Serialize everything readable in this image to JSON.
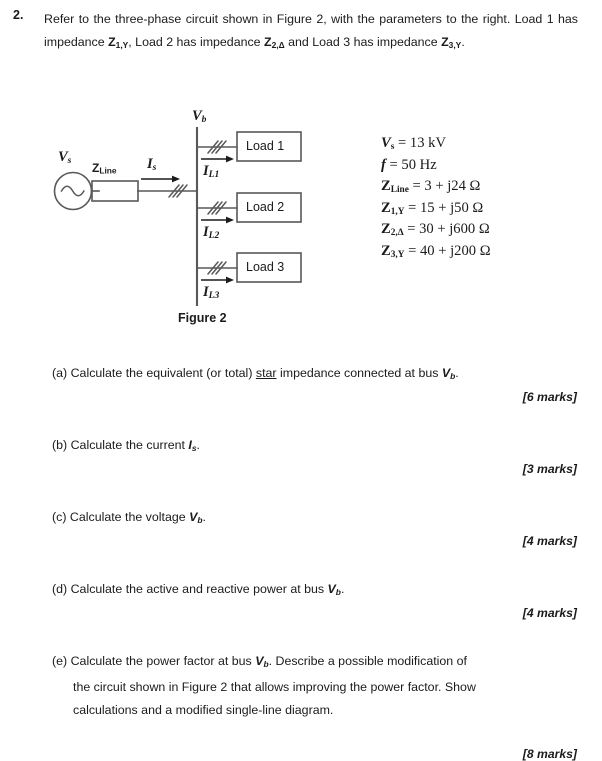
{
  "question": {
    "number": "2.",
    "stem_line1": "Refer to the three-phase circuit shown in Figure 2, with the parameters to the",
    "stem_line2_a": "right. Load 1 has impedance ",
    "stem_line2_z1": "Z",
    "stem_line2_z1sub": "1,Y",
    "stem_line2_b": ", Load 2 has impedance ",
    "stem_line2_z2": "Z",
    "stem_line2_z2sub": "2,Δ",
    "stem_line2_c": " and Load 3 has",
    "stem_line3_a": "impedance ",
    "stem_line3_z3": "Z",
    "stem_line3_z3sub": "3,Y",
    "stem_line3_b": "."
  },
  "figure": {
    "caption": "Figure 2",
    "source_label": "V",
    "source_sub": "s",
    "line_impedance_label": "Z",
    "line_impedance_sub": "Line",
    "source_current_label": "I",
    "source_current_sub": "s",
    "bus_label": "V",
    "bus_sub": "b",
    "loads": [
      {
        "name": "Load 1",
        "current_label": "I",
        "current_sub": "L1"
      },
      {
        "name": "Load 2",
        "current_label": "I",
        "current_sub": "L2"
      },
      {
        "name": "Load 3",
        "current_label": "I",
        "current_sub": "L3"
      }
    ]
  },
  "parameters": [
    {
      "symbol": "V",
      "sub": "s",
      "italic": true,
      "value": "= 13 kV"
    },
    {
      "symbol": "f",
      "sub": "",
      "italic": true,
      "value": "= 50 Hz"
    },
    {
      "symbol": "Z",
      "sub": "Line",
      "italic": false,
      "value": "= 3 + j24 Ω"
    },
    {
      "symbol": "Z",
      "sub": "1,Y",
      "italic": false,
      "value": "= 15 + j50 Ω"
    },
    {
      "symbol": "Z",
      "sub": "2,Δ",
      "italic": false,
      "value": "= 30 + j600 Ω"
    },
    {
      "symbol": "Z",
      "sub": "3,Y",
      "italic": false,
      "value": "= 40 + j200 Ω"
    }
  ],
  "parts": [
    {
      "label": "(a)",
      "text_a": "Calculate the equivalent (or total) ",
      "underlined": "star",
      "text_b": " impedance connected at bus ",
      "symbol": "V",
      "symbol_sub": "b",
      "text_c": ".",
      "marks": "[6 marks]"
    },
    {
      "label": "(b)",
      "text_a": "Calculate the current ",
      "symbol": "I",
      "symbol_sub": "s",
      "text_c": ".",
      "marks": "[3 marks]"
    },
    {
      "label": "(c)",
      "text_a": "Calculate the voltage ",
      "symbol": "V",
      "symbol_sub": "b",
      "text_c": ".",
      "marks": "[4 marks]"
    },
    {
      "label": "(d)",
      "text_a": "Calculate the active and reactive power at bus ",
      "symbol": "V",
      "symbol_sub": "b",
      "text_c": ".",
      "marks": "[4 marks]"
    },
    {
      "label": "(e)",
      "text_a": "Calculate the power factor at bus ",
      "symbol": "V",
      "symbol_sub": "b",
      "text_c": ". Describe a possible modification of",
      "text_line2": "the circuit shown in Figure 2 that allows improving the power factor. Show",
      "text_line3": "calculations and a modified single-line diagram.",
      "marks": "[8 marks]"
    }
  ],
  "colors": {
    "text": "#1b1b1b",
    "line": "#58585a",
    "background": "#ffffff"
  }
}
